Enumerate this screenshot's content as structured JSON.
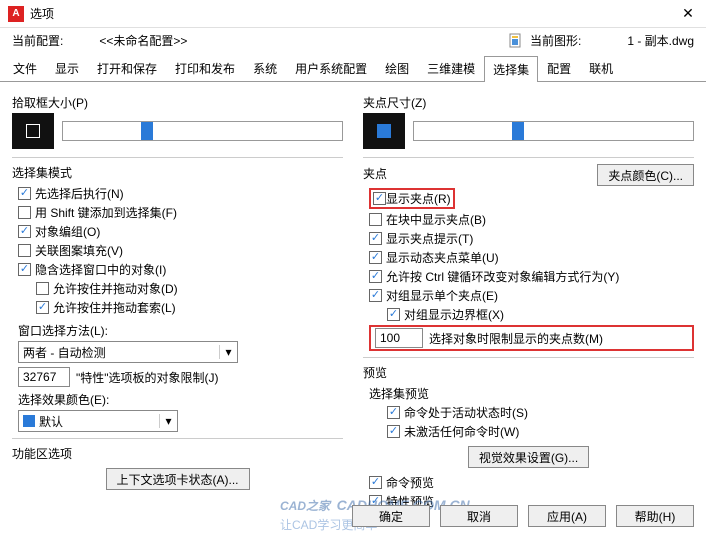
{
  "window": {
    "title": "选项"
  },
  "profile": {
    "current_label": "当前配置:",
    "current_value": "<<未命名配置>>",
    "drawing_label": "当前图形:",
    "drawing_value": "1 - 副本.dwg"
  },
  "tabs": [
    "文件",
    "显示",
    "打开和保存",
    "打印和发布",
    "系统",
    "用户系统配置",
    "绘图",
    "三维建模",
    "选择集",
    "配置",
    "联机"
  ],
  "active_tab": 8,
  "left": {
    "pickbox_label": "拾取框大小(P)",
    "mode_label": "选择集模式",
    "checks": {
      "pre_select": {
        "label": "先选择后执行(N)",
        "checked": true
      },
      "shift_add": {
        "label": "用 Shift 键添加到选择集(F)",
        "checked": false
      },
      "object_group": {
        "label": "对象编组(O)",
        "checked": true
      },
      "assoc_hatch": {
        "label": "关联图案填充(V)",
        "checked": false
      },
      "implied_window": {
        "label": "隐含选择窗口中的对象(I)",
        "checked": true
      },
      "allow_press_drag": {
        "label": "允许按住并拖动对象(D)",
        "checked": false
      },
      "allow_press_drag_lasso": {
        "label": "允许按住并拖动套索(L)",
        "checked": true
      }
    },
    "window_method_label": "窗口选择方法(L):",
    "window_method_value": "两者 - 自动检测",
    "prop_limit_value": "32767",
    "prop_limit_label": "\"特性\"选项板的对象限制(J)",
    "effect_color_label": "选择效果颜色(E):",
    "effect_color_value": "默认",
    "ribbon_label": "功能区选项",
    "ribbon_btn": "上下文选项卡状态(A)..."
  },
  "right": {
    "gripsize_label": "夹点尺寸(Z)",
    "grips_label": "夹点",
    "grip_color_btn": "夹点颜色(C)...",
    "checks": {
      "show_grips": {
        "label": "显示夹点(R)",
        "checked": true
      },
      "grips_in_blocks": {
        "label": "在块中显示夹点(B)",
        "checked": false
      },
      "grip_tips": {
        "label": "显示夹点提示(T)",
        "checked": true
      },
      "dynamic_menu": {
        "label": "显示动态夹点菜单(U)",
        "checked": true
      },
      "ctrl_cycle": {
        "label": "允许按 Ctrl 键循环改变对象编辑方式行为(Y)",
        "checked": true
      },
      "group_single": {
        "label": "对组显示单个夹点(E)",
        "checked": true
      },
      "group_bbox": {
        "label": "对组显示边界框(X)",
        "checked": true
      }
    },
    "grip_limit_value": "100",
    "grip_limit_label": "选择对象时限制显示的夹点数(M)",
    "preview_label": "预览",
    "sel_preview_label": "选择集预览",
    "preview_checks": {
      "cmd_active": {
        "label": "命令处于活动状态时(S)",
        "checked": true
      },
      "no_cmd_active": {
        "label": "未激活任何命令时(W)",
        "checked": true
      }
    },
    "visual_effect_btn": "视觉效果设置(G)...",
    "cmd_preview": {
      "label": "命令预览",
      "checked": true
    },
    "prop_preview": {
      "label": "特性预览",
      "checked": true
    }
  },
  "buttons": {
    "ok": "确定",
    "cancel": "取消",
    "apply": "应用(A)",
    "help": "帮助(H)"
  },
  "watermark": {
    "line1": "CAD之家",
    "line2": "CADHOME.COM.CN",
    "line3": "让CAD学习更简单"
  }
}
